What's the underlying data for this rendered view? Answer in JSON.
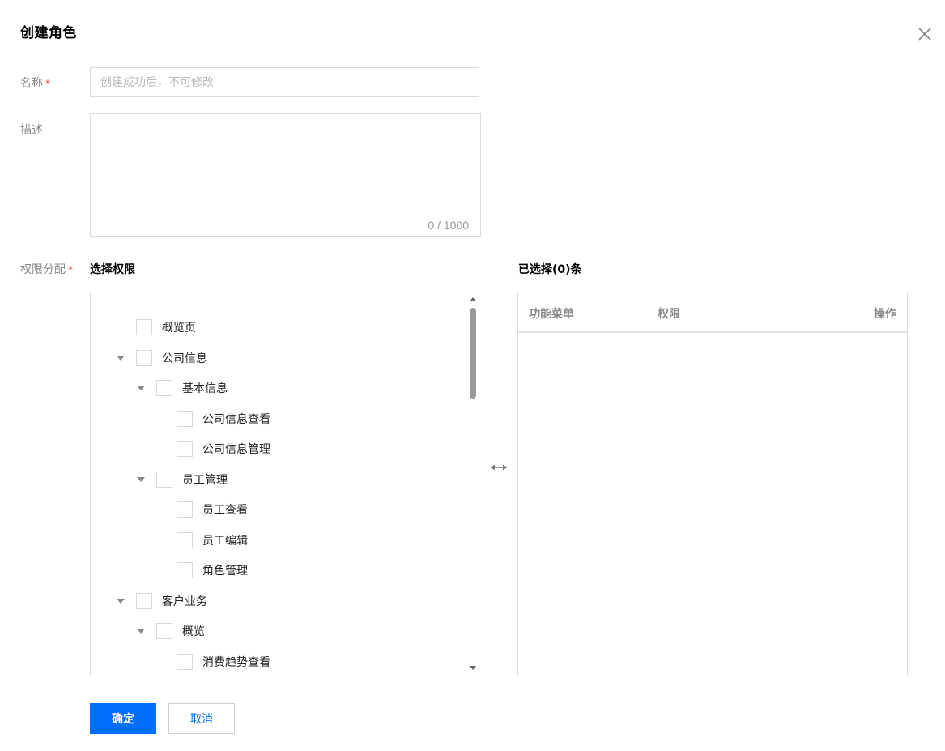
{
  "dialog": {
    "title": "创建角色"
  },
  "form": {
    "name": {
      "label": "名称",
      "required_mark": "*",
      "value": "",
      "placeholder": "创建成功后，不可修改"
    },
    "description": {
      "label": "描述",
      "value": "",
      "counter": "0 / 1000"
    },
    "permissions": {
      "label": "权限分配",
      "required_mark": "*"
    }
  },
  "permission_tree": {
    "title": "选择权限",
    "nodes": [
      {
        "label": "概览页",
        "level": 1,
        "expandable": false
      },
      {
        "label": "公司信息",
        "level": 1,
        "expandable": true
      },
      {
        "label": "基本信息",
        "level": 2,
        "expandable": true
      },
      {
        "label": "公司信息查看",
        "level": 3,
        "expandable": false
      },
      {
        "label": "公司信息管理",
        "level": 3,
        "expandable": false
      },
      {
        "label": "员工管理",
        "level": 2,
        "expandable": true
      },
      {
        "label": "员工查看",
        "level": 3,
        "expandable": false
      },
      {
        "label": "员工编辑",
        "level": 3,
        "expandable": false
      },
      {
        "label": "角色管理",
        "level": 3,
        "expandable": false
      },
      {
        "label": "客户业务",
        "level": 1,
        "expandable": true
      },
      {
        "label": "概览",
        "level": 2,
        "expandable": true
      },
      {
        "label": "消费趋势查看",
        "level": 3,
        "expandable": false
      }
    ]
  },
  "selected": {
    "title": "已选择(0)条",
    "columns": {
      "menu": "功能菜单",
      "permission": "权限",
      "action": "操作"
    }
  },
  "buttons": {
    "confirm": "确定",
    "cancel": "取消"
  },
  "colors": {
    "primary": "#006eff",
    "required": "#e54545"
  }
}
